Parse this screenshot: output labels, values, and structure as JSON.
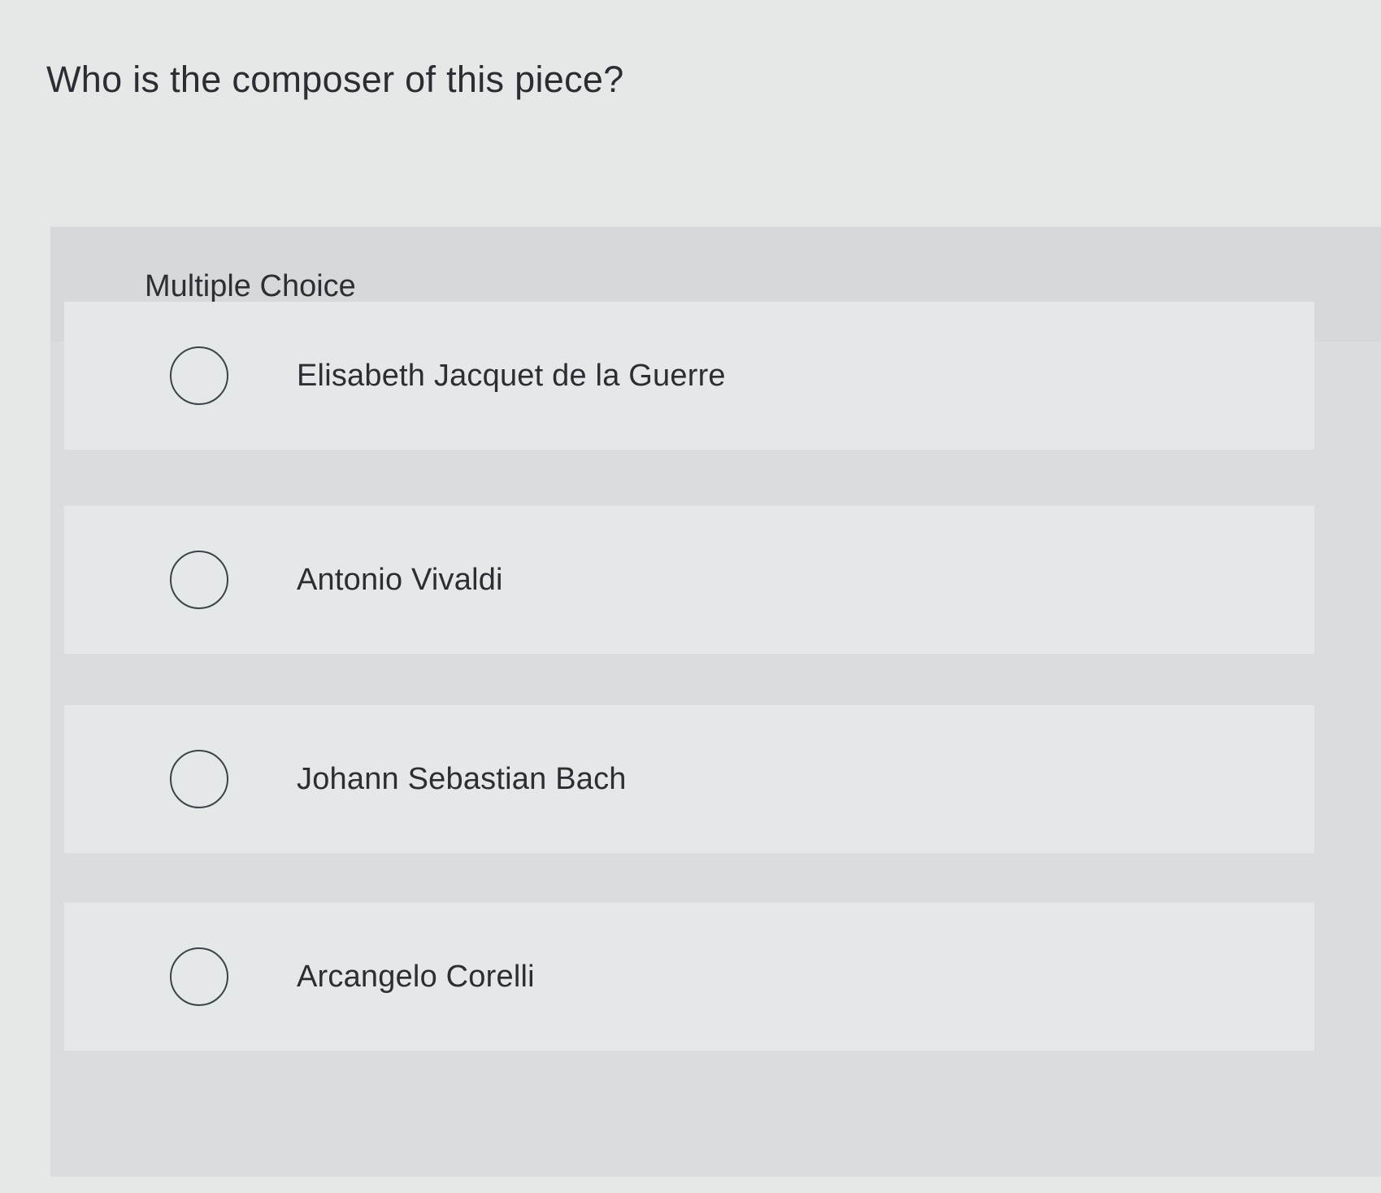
{
  "question": {
    "text": "Who is the composer of this piece?"
  },
  "multiple_choice": {
    "label": "Multiple Choice",
    "options": [
      {
        "label": "Elisabeth Jacquet de la Guerre",
        "selected": false
      },
      {
        "label": "Antonio Vivaldi",
        "selected": false
      },
      {
        "label": "Johann Sebastian Bach",
        "selected": false
      },
      {
        "label": "Arcangelo Corelli",
        "selected": false
      }
    ]
  },
  "colors": {
    "background": "#e6e8e8",
    "panel": "#dadddd",
    "option_card": "#e5e8e8",
    "text": "#2b2f33",
    "radio_border": "#3d4248"
  },
  "icons": {
    "radio": "radio-unselected-icon"
  }
}
